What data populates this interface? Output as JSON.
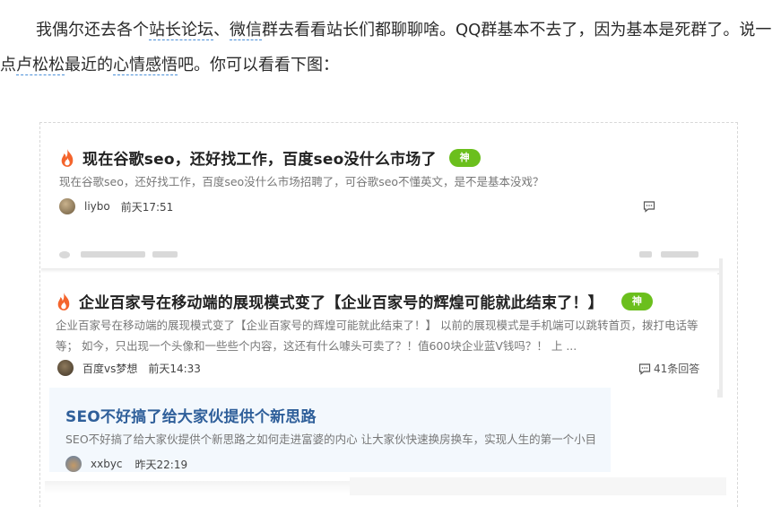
{
  "article": {
    "p1": "我偶尔还去各个",
    "link1": "站长论坛",
    "p2": "、",
    "link2": "微信",
    "p3": "群去看看站长们都聊聊啥。QQ群基本不去了，因为基本是死群了。说一点",
    "link3": "卢松松",
    "p4": "最近的",
    "link4": "心情感悟",
    "p5": "吧。你可以看看下图："
  },
  "posts": [
    {
      "title": "现在谷歌seo，还好找工作，百度seo没什么市场了",
      "badge": "神",
      "summary": "现在谷歌seo，还好找工作，百度seo没什么市场招聘了，可谷歌seo不懂英文，是不是基本没戏？",
      "author": "liybo",
      "time": "前天17:51",
      "replies": ""
    },
    {
      "title": "企业百家号在移动端的展现模式变了【企业百家号的辉煌可能就此结束了！】",
      "badge": "神",
      "summary": "企业百家号在移动端的展现模式变了【企业百家号的辉煌可能就此结束了！】 以前的展现模式是手机端可以跳转首页，拨打电话等等；  如今，只出现一个头像和一些些个内容，这还有什么噱头可卖了？！值600块企业蓝V钱吗？！ 上 ...",
      "author": "百度vs梦想",
      "time": "前天14:33",
      "replies": "41条回答"
    },
    {
      "title": "SEO不好搞了给大家伙提供个新思路",
      "summary": "SEO不好搞了给大家伙提供个新思路之如何走进富婆的内心 让大家伙快速换房换车，实现人生的第一个小目",
      "author": "xxbyc",
      "time": "昨天22:19"
    }
  ],
  "colors": {
    "badge": "#6bbf1d",
    "fire": "#f4642c",
    "link_underline": "#4a8fd8",
    "highlight_bg": "#f3f8fd",
    "title_blue": "#2f5f9a"
  },
  "icons": [
    "fire-icon",
    "comment-icon"
  ]
}
